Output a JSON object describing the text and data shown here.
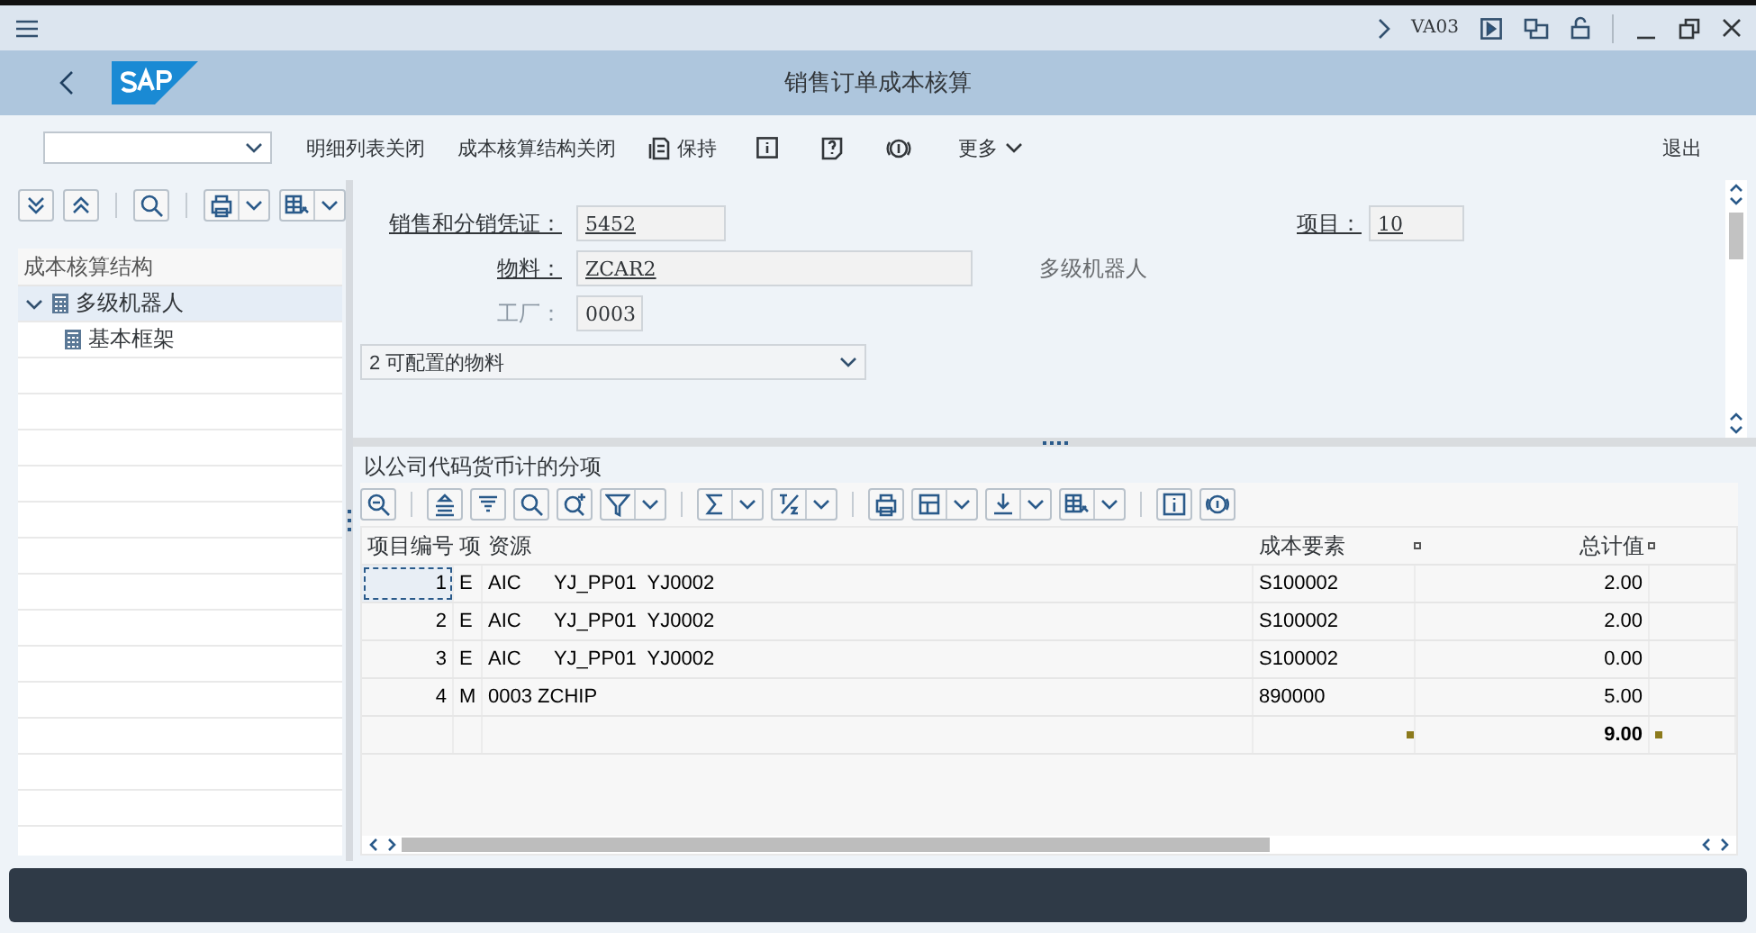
{
  "top_bar": {
    "transaction_code": "VA03"
  },
  "header": {
    "title": "销售订单成本核算"
  },
  "toolbar": {
    "buttons": [
      {
        "kind": "text",
        "label": "明细列表关闭"
      },
      {
        "kind": "text",
        "label": "成本核算结构关闭"
      },
      {
        "kind": "labeled",
        "label": "保持"
      },
      {
        "kind": "info"
      },
      {
        "kind": "help"
      },
      {
        "kind": "currency"
      },
      {
        "kind": "menu",
        "label": "更多"
      }
    ],
    "exit": "退出"
  },
  "tree": {
    "title": "成本核算结构",
    "items": [
      {
        "label": "多级机器人",
        "expanded": true,
        "selected": true,
        "children": [
          {
            "label": "基本框架",
            "selected": false
          }
        ]
      }
    ]
  },
  "form": {
    "fields": [
      {
        "label": "销售和分销凭证：",
        "value": "5452",
        "link": true
      },
      {
        "label": "项目：",
        "value": "10",
        "link": true
      },
      {
        "label": "物料：",
        "value": "ZCAR2",
        "link": true,
        "description": "多级机器人"
      },
      {
        "label": "工厂：",
        "value": "0003",
        "link": false
      }
    ],
    "category": "2 可配置的物料"
  },
  "grid": {
    "title": "以公司代码货币计的分项",
    "columns": [
      "项目编号",
      "项",
      "资源",
      "成本要素",
      "总计值"
    ],
    "rows": [
      {
        "cells": [
          "1",
          "E",
          "AIC      YJ_PP01  YJ0002",
          "S100002",
          "2.00"
        ],
        "focused": true
      },
      {
        "cells": [
          "2",
          "E",
          "AIC      YJ_PP01  YJ0002",
          "S100002",
          "2.00"
        ],
        "focused": false
      },
      {
        "cells": [
          "3",
          "E",
          "AIC      YJ_PP01  YJ0002",
          "S100002",
          "0.00"
        ],
        "focused": false
      },
      {
        "cells": [
          "4",
          "M",
          "0003 ZCHIP",
          "890000",
          "5.00"
        ],
        "focused": false
      }
    ],
    "total": "9.00"
  }
}
